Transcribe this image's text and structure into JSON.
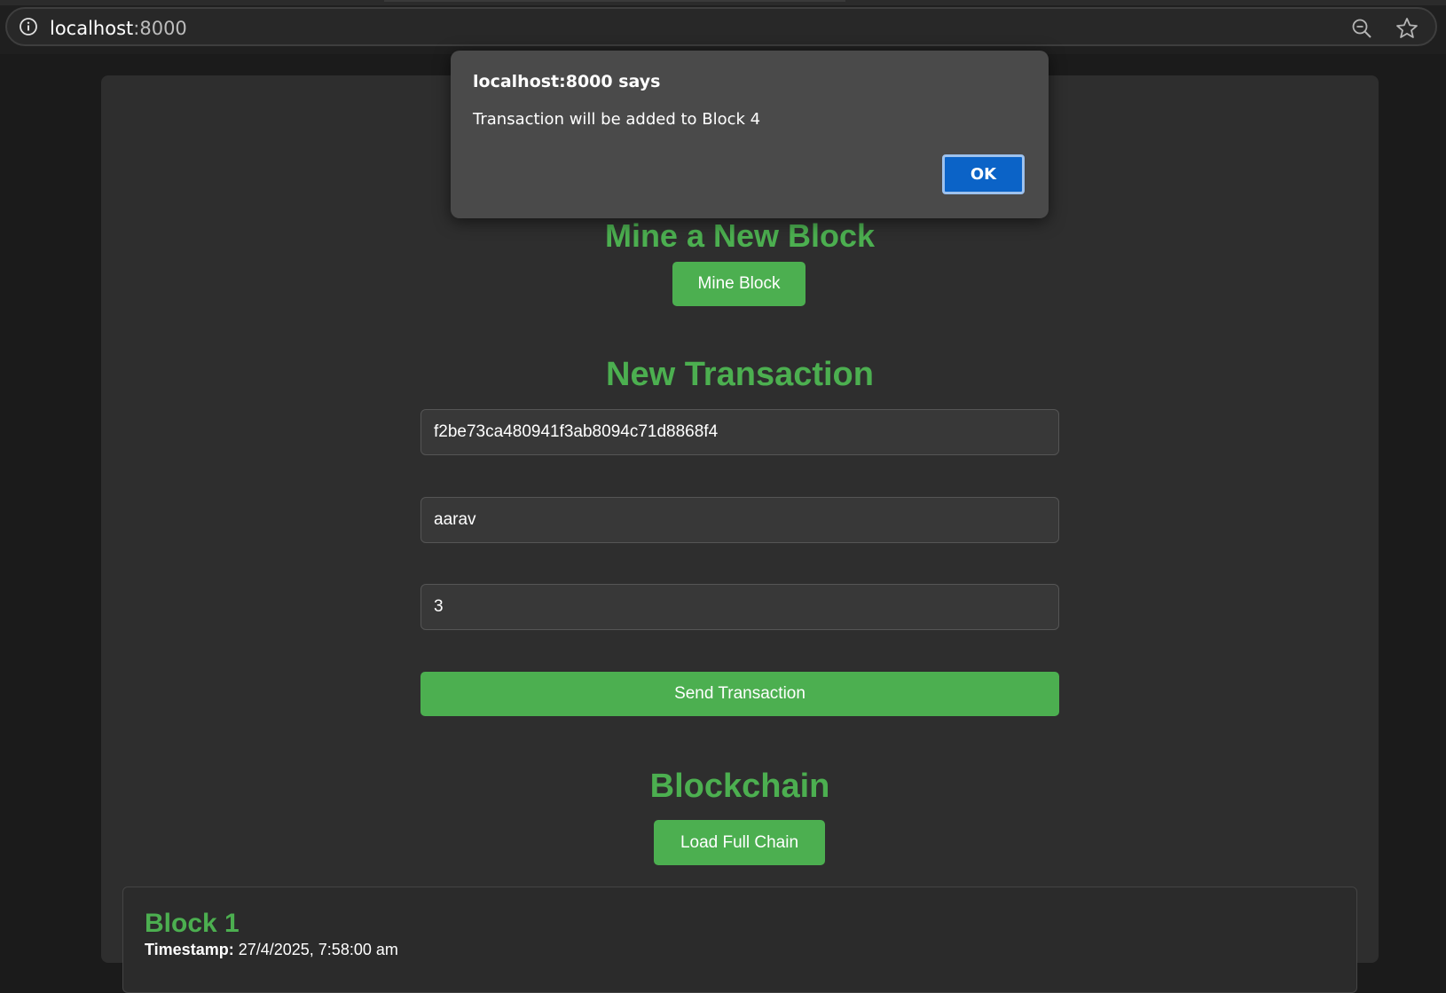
{
  "browser": {
    "url_host": "localhost",
    "url_port": ":8000",
    "icons": [
      "info-icon",
      "zoom-out-icon",
      "bookmark-star-icon"
    ]
  },
  "mine": {
    "title": "Mine a New Block",
    "button_label": "Mine Block"
  },
  "transaction": {
    "title": "New Transaction",
    "sender_value": "f2be73ca480941f3ab8094c71d8868f4",
    "recipient_value": "aarav",
    "amount_value": "3",
    "send_label": "Send Transaction"
  },
  "blockchain": {
    "title": "Blockchain",
    "load_label": "Load Full Chain",
    "blocks": [
      {
        "title": "Block 1",
        "timestamp_label": "Timestamp:",
        "timestamp_value": "27/4/2025, 7:58:00 am"
      }
    ]
  },
  "dialog": {
    "title": "localhost:8000 says",
    "message": "Transaction will be added to Block 4",
    "ok_label": "OK"
  },
  "colors": {
    "accent_green": "#4caf50",
    "dialog_button_blue": "#0b63c7",
    "page_background": "#1b1b1b",
    "card_background": "#2e2e2e"
  }
}
